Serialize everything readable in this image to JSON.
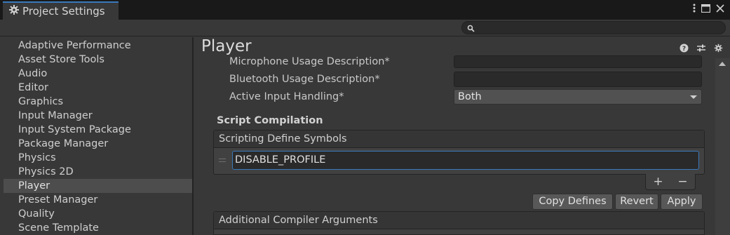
{
  "window": {
    "tab_title": "Project Settings",
    "icons": [
      "gear-icon",
      "kebab-menu-icon",
      "maximize-icon",
      "close-icon"
    ]
  },
  "search": {
    "value": "",
    "placeholder": ""
  },
  "sidebar": {
    "items": [
      {
        "label": "Adaptive Performance",
        "selected": false
      },
      {
        "label": "Asset Store Tools",
        "selected": false
      },
      {
        "label": "Audio",
        "selected": false
      },
      {
        "label": "Editor",
        "selected": false
      },
      {
        "label": "Graphics",
        "selected": false
      },
      {
        "label": "Input Manager",
        "selected": false
      },
      {
        "label": "Input System Package",
        "selected": false
      },
      {
        "label": "Package Manager",
        "selected": false
      },
      {
        "label": "Physics",
        "selected": false
      },
      {
        "label": "Physics 2D",
        "selected": false
      },
      {
        "label": "Player",
        "selected": true
      },
      {
        "label": "Preset Manager",
        "selected": false
      },
      {
        "label": "Quality",
        "selected": false
      },
      {
        "label": "Scene Template",
        "selected": false
      }
    ]
  },
  "main": {
    "title": "Player",
    "header_icons": [
      "help-icon",
      "preset-icon",
      "settings-icon"
    ],
    "fields": {
      "microphone_label": "Microphone Usage Description*",
      "microphone_value": "",
      "bluetooth_label": "Bluetooth Usage Description*",
      "bluetooth_value": "",
      "input_handling_label": "Active Input Handling*",
      "input_handling_value": "Both"
    },
    "script_compilation": {
      "section_title": "Script Compilation",
      "list_header": "Scripting Define Symbols",
      "symbols": [
        "DISABLE_PROFILE"
      ],
      "add_label": "+",
      "remove_label": "−",
      "copy_defines_label": "Copy Defines",
      "revert_label": "Revert",
      "apply_label": "Apply",
      "compiler_args_header": "Additional Compiler Arguments"
    }
  },
  "colors": {
    "accent": "#3a79bb",
    "background": "#383838",
    "selected_item": "#4d4d4d"
  }
}
